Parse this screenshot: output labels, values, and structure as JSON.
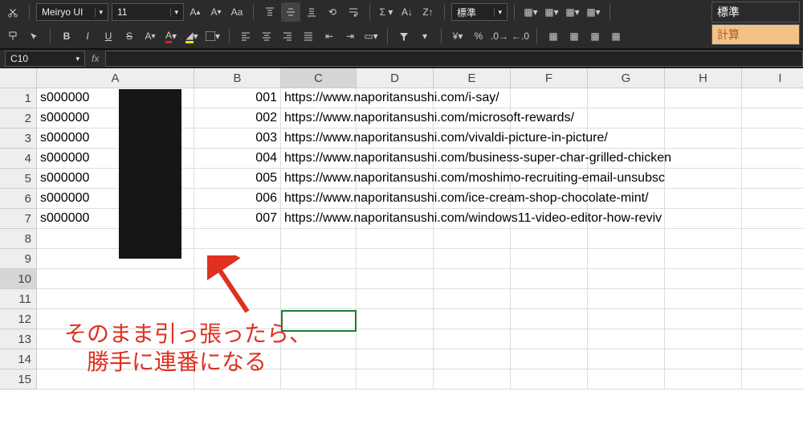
{
  "toolbar": {
    "font_name": "Meiryo UI",
    "font_size": "11",
    "number_format": "標準",
    "row2": {
      "bold": "B",
      "italic": "I",
      "underline": "U",
      "strike": "S"
    }
  },
  "styles": {
    "standard": "標準",
    "calculation": "計算"
  },
  "namebox": "C10",
  "fx_label": "fx",
  "columns": [
    "A",
    "B",
    "C",
    "D",
    "E",
    "F",
    "G",
    "H",
    "I"
  ],
  "rows": [
    "1",
    "2",
    "3",
    "4",
    "5",
    "6",
    "7",
    "8",
    "9",
    "10",
    "11",
    "12",
    "13",
    "14",
    "15"
  ],
  "cells": {
    "A1": "s000000",
    "B1": "001",
    "C1": "https://www.naporitansushi.com/i-say/",
    "A2": "s000000",
    "B2": "002",
    "C2": "https://www.naporitansushi.com/microsoft-rewards/",
    "A3": "s000000",
    "B3": "003",
    "C3": "https://www.naporitansushi.com/vivaldi-picture-in-picture/",
    "A4": "s000000",
    "B4": "004",
    "C4": "https://www.naporitansushi.com/business-super-char-grilled-chicken",
    "A5": "s000000",
    "B5": "005",
    "C5": "https://www.naporitansushi.com/moshimo-recruiting-email-unsubsc",
    "A6": "s000000",
    "B6": "006",
    "C6": "https://www.naporitansushi.com/ice-cream-shop-chocolate-mint/",
    "A7": "s000000",
    "B7": "007",
    "C7": "https://www.naporitansushi.com/windows11-video-editor-how-reviv"
  },
  "selected_cell": "C10",
  "annotation": {
    "line1": "そのまま引っ張ったら、",
    "line2": "勝手に連番になる"
  },
  "colors": {
    "accent": "#1a7a3a",
    "arrow": "#e03020"
  }
}
